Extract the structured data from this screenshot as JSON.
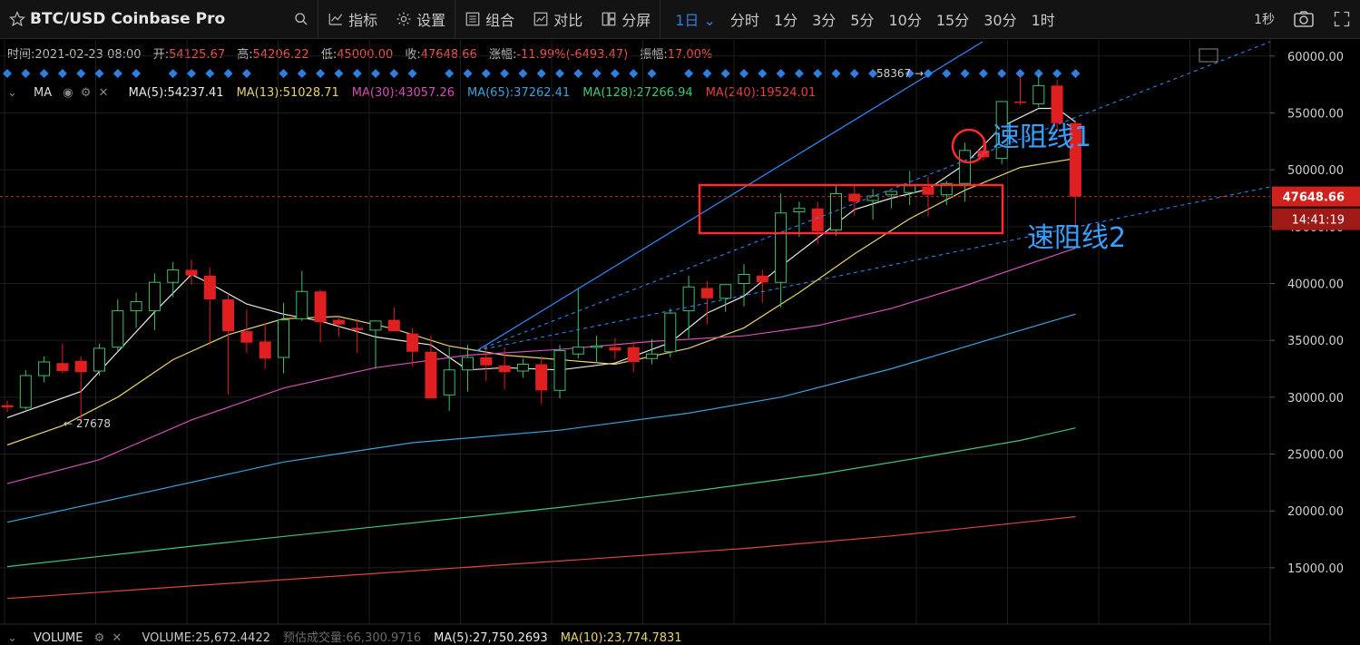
{
  "toolbar": {
    "symbol": "BTC/USD Coinbase Pro",
    "indicators_label": "指标",
    "settings_label": "设置",
    "combo_label": "组合",
    "compare_label": "对比",
    "split_label": "分屏",
    "timeframes": [
      "1日",
      "分时",
      "1分",
      "3分",
      "5分",
      "10分",
      "15分",
      "30分",
      "1时"
    ],
    "active_timeframe": "1日",
    "refresh_label": "1秒",
    "icons": [
      "star-icon",
      "search-icon",
      "indicator-icon",
      "gear-icon",
      "combo-icon",
      "compare-icon",
      "split-icon",
      "camera-icon",
      "fullscreen-icon"
    ]
  },
  "ohlc": {
    "time_label": "时间:",
    "time": "2021-02-23 08:00",
    "open_label": "开:",
    "open": "54125.67",
    "high_label": "高:",
    "high": "54206.22",
    "low_label": "低:",
    "low": "45000.00",
    "close_label": "收:",
    "close": "47648.66",
    "change_label": "涨幅:",
    "change": "-11.99%(-6493.47)",
    "amp_label": "振幅:",
    "amp": "17.00%"
  },
  "ma_legend": {
    "name": "MA",
    "items": [
      {
        "text": "MA(5):54237.41",
        "color": "#e8e8e8"
      },
      {
        "text": "MA(13):51028.71",
        "color": "#e8d36a"
      },
      {
        "text": "MA(30):43057.26",
        "color": "#d64fb5"
      },
      {
        "text": "MA(65):37262.41",
        "color": "#3aa3dd"
      },
      {
        "text": "MA(128):27266.94",
        "color": "#3ec777"
      },
      {
        "text": "MA(240):19524.01",
        "color": "#e0443e"
      }
    ]
  },
  "volume_legend": {
    "name": "VOLUME",
    "items": [
      {
        "text": "VOLUME:25,672.4422",
        "color": "#c8c8c8"
      },
      {
        "text": "预估成交量:66,300.9716",
        "color": "#6a6a6a"
      },
      {
        "text": "MA(5):27,750.2693",
        "color": "#e8e8e8"
      },
      {
        "text": "MA(10):23,774.7831",
        "color": "#e8d36a"
      }
    ]
  },
  "chart_data": {
    "type": "candlestick",
    "ylim": [
      11000,
      62000
    ],
    "y_ticks": [
      "60000.00",
      "55000.00",
      "50000.00",
      "45000.00",
      "40000.00",
      "35000.00",
      "30000.00",
      "25000.00",
      "20000.00",
      "15000.00"
    ],
    "y_tick_values": [
      60000,
      55000,
      50000,
      45000,
      40000,
      35000,
      30000,
      25000,
      20000,
      15000
    ],
    "last_price": "47648.66",
    "last_price_value": 47648.66,
    "countdown": "14:41:19",
    "high_marker": "58367",
    "low_marker": "27678",
    "candles": [
      [
        29300,
        29700,
        28700,
        29100
      ],
      [
        29100,
        32400,
        28900,
        31900
      ],
      [
        31900,
        33600,
        31300,
        33100
      ],
      [
        33000,
        34700,
        32100,
        32300
      ],
      [
        33200,
        33600,
        27700,
        32200
      ],
      [
        32300,
        34700,
        31900,
        34300
      ],
      [
        34400,
        38600,
        34100,
        37600
      ],
      [
        37600,
        39200,
        36100,
        38400
      ],
      [
        37600,
        40900,
        35900,
        40100
      ],
      [
        40100,
        41900,
        38800,
        41200
      ],
      [
        41200,
        42100,
        39900,
        40700
      ],
      [
        40700,
        41400,
        34600,
        38600
      ],
      [
        38600,
        39100,
        30200,
        35800
      ],
      [
        35800,
        37700,
        33900,
        34800
      ],
      [
        34900,
        36500,
        32500,
        33400
      ],
      [
        33500,
        38300,
        32100,
        36800
      ],
      [
        36900,
        41100,
        36700,
        39300
      ],
      [
        39300,
        39500,
        34800,
        36600
      ],
      [
        36800,
        37100,
        35300,
        36400
      ],
      [
        36100,
        36900,
        33900,
        35900
      ],
      [
        35900,
        36500,
        32500,
        36700
      ],
      [
        36800,
        37900,
        35800,
        35800
      ],
      [
        35600,
        36100,
        32700,
        34000
      ],
      [
        34000,
        35400,
        30200,
        29900
      ],
      [
        30200,
        34400,
        28800,
        32400
      ],
      [
        32400,
        34600,
        30500,
        33500
      ],
      [
        33500,
        34600,
        31400,
        32800
      ],
      [
        32800,
        34400,
        30700,
        32200
      ],
      [
        32300,
        33400,
        31700,
        32900
      ],
      [
        32900,
        33600,
        29400,
        30600
      ],
      [
        30600,
        34600,
        29900,
        34100
      ],
      [
        33800,
        39600,
        33400,
        34400
      ],
      [
        34400,
        35400,
        33000,
        34500
      ],
      [
        34400,
        35200,
        33300,
        34100
      ],
      [
        34400,
        34900,
        32200,
        33100
      ],
      [
        33400,
        35100,
        32900,
        33800
      ],
      [
        34000,
        37800,
        33500,
        37400
      ],
      [
        37600,
        40700,
        35200,
        39700
      ],
      [
        39600,
        40200,
        36400,
        38700
      ],
      [
        38700,
        39800,
        37500,
        39900
      ],
      [
        40000,
        41700,
        38000,
        40800
      ],
      [
        40700,
        41200,
        38300,
        40100
      ],
      [
        40100,
        47900,
        37900,
        46200
      ],
      [
        46300,
        47200,
        44100,
        46600
      ],
      [
        46600,
        47200,
        43500,
        44600
      ],
      [
        44700,
        48700,
        44200,
        47900
      ],
      [
        47900,
        48700,
        46000,
        47200
      ],
      [
        47300,
        48300,
        45600,
        47700
      ],
      [
        47800,
        48100,
        46600,
        48100
      ],
      [
        48000,
        49900,
        46900,
        48600
      ],
      [
        48500,
        49400,
        45900,
        47800
      ],
      [
        47800,
        49000,
        46900,
        48800
      ],
      [
        48800,
        52400,
        47200,
        51700
      ],
      [
        51700,
        52600,
        50800,
        51100
      ],
      [
        51000,
        56000,
        50500,
        56000
      ],
      [
        56000,
        58300,
        55700,
        55900
      ],
      [
        55800,
        58400,
        55500,
        57400
      ],
      [
        57400,
        57900,
        53400,
        54100
      ],
      [
        54100,
        54200,
        45000,
        47649
      ]
    ],
    "ma_series": [
      {
        "name": "MA(5)",
        "color": "#e8e8e8",
        "points": [
          [
            0,
            28200
          ],
          [
            4,
            30500
          ],
          [
            8,
            37500
          ],
          [
            10,
            40800
          ],
          [
            11,
            40000
          ],
          [
            13,
            38200
          ],
          [
            15,
            37300
          ],
          [
            17,
            36700
          ],
          [
            20,
            35300
          ],
          [
            23,
            34600
          ],
          [
            25,
            32400
          ],
          [
            27,
            32600
          ],
          [
            30,
            32400
          ],
          [
            33,
            33000
          ],
          [
            36,
            34800
          ],
          [
            38,
            37400
          ],
          [
            40,
            38900
          ],
          [
            42,
            41500
          ],
          [
            44,
            44000
          ],
          [
            46,
            46500
          ],
          [
            48,
            47500
          ],
          [
            50,
            48300
          ],
          [
            52,
            50500
          ],
          [
            54,
            53800
          ],
          [
            56,
            55400
          ],
          [
            57,
            55400
          ],
          [
            58,
            54200
          ]
        ]
      },
      {
        "name": "MA(13)",
        "color": "#e8d36a",
        "points": [
          [
            0,
            25800
          ],
          [
            3,
            27500
          ],
          [
            6,
            30000
          ],
          [
            9,
            33300
          ],
          [
            12,
            35500
          ],
          [
            15,
            36900
          ],
          [
            18,
            37100
          ],
          [
            21,
            36000
          ],
          [
            24,
            34500
          ],
          [
            27,
            33700
          ],
          [
            30,
            33300
          ],
          [
            33,
            32900
          ],
          [
            37,
            34300
          ],
          [
            40,
            36100
          ],
          [
            43,
            39200
          ],
          [
            46,
            42600
          ],
          [
            49,
            45700
          ],
          [
            52,
            48200
          ],
          [
            55,
            50200
          ],
          [
            58,
            51000
          ]
        ]
      },
      {
        "name": "MA(30)",
        "color": "#d64fb5",
        "points": [
          [
            0,
            22400
          ],
          [
            5,
            24500
          ],
          [
            10,
            28000
          ],
          [
            15,
            30800
          ],
          [
            20,
            32600
          ],
          [
            25,
            33700
          ],
          [
            30,
            34200
          ],
          [
            35,
            34900
          ],
          [
            40,
            35400
          ],
          [
            44,
            36300
          ],
          [
            48,
            37800
          ],
          [
            52,
            39800
          ],
          [
            56,
            42000
          ],
          [
            58,
            43100
          ]
        ]
      },
      {
        "name": "MA(65)",
        "color": "#3aa3dd",
        "points": [
          [
            0,
            19000
          ],
          [
            8,
            21800
          ],
          [
            15,
            24300
          ],
          [
            22,
            26000
          ],
          [
            30,
            27100
          ],
          [
            37,
            28600
          ],
          [
            42,
            30000
          ],
          [
            48,
            32500
          ],
          [
            54,
            35400
          ],
          [
            58,
            37300
          ]
        ]
      },
      {
        "name": "MA(128)",
        "color": "#3ec777",
        "points": [
          [
            0,
            15100
          ],
          [
            10,
            16900
          ],
          [
            20,
            18600
          ],
          [
            30,
            20300
          ],
          [
            38,
            21900
          ],
          [
            44,
            23200
          ],
          [
            50,
            24800
          ],
          [
            55,
            26200
          ],
          [
            58,
            27300
          ]
        ]
      },
      {
        "name": "MA(240)",
        "color": "#e0443e",
        "points": [
          [
            0,
            12300
          ],
          [
            10,
            13400
          ],
          [
            20,
            14500
          ],
          [
            30,
            15600
          ],
          [
            40,
            16700
          ],
          [
            48,
            17800
          ],
          [
            54,
            18800
          ],
          [
            58,
            19500
          ]
        ]
      }
    ],
    "annotations": [
      {
        "text": "速阻线1",
        "color": "#3aa0ff"
      },
      {
        "text": "速阻线2",
        "color": "#3aa0ff"
      }
    ]
  }
}
